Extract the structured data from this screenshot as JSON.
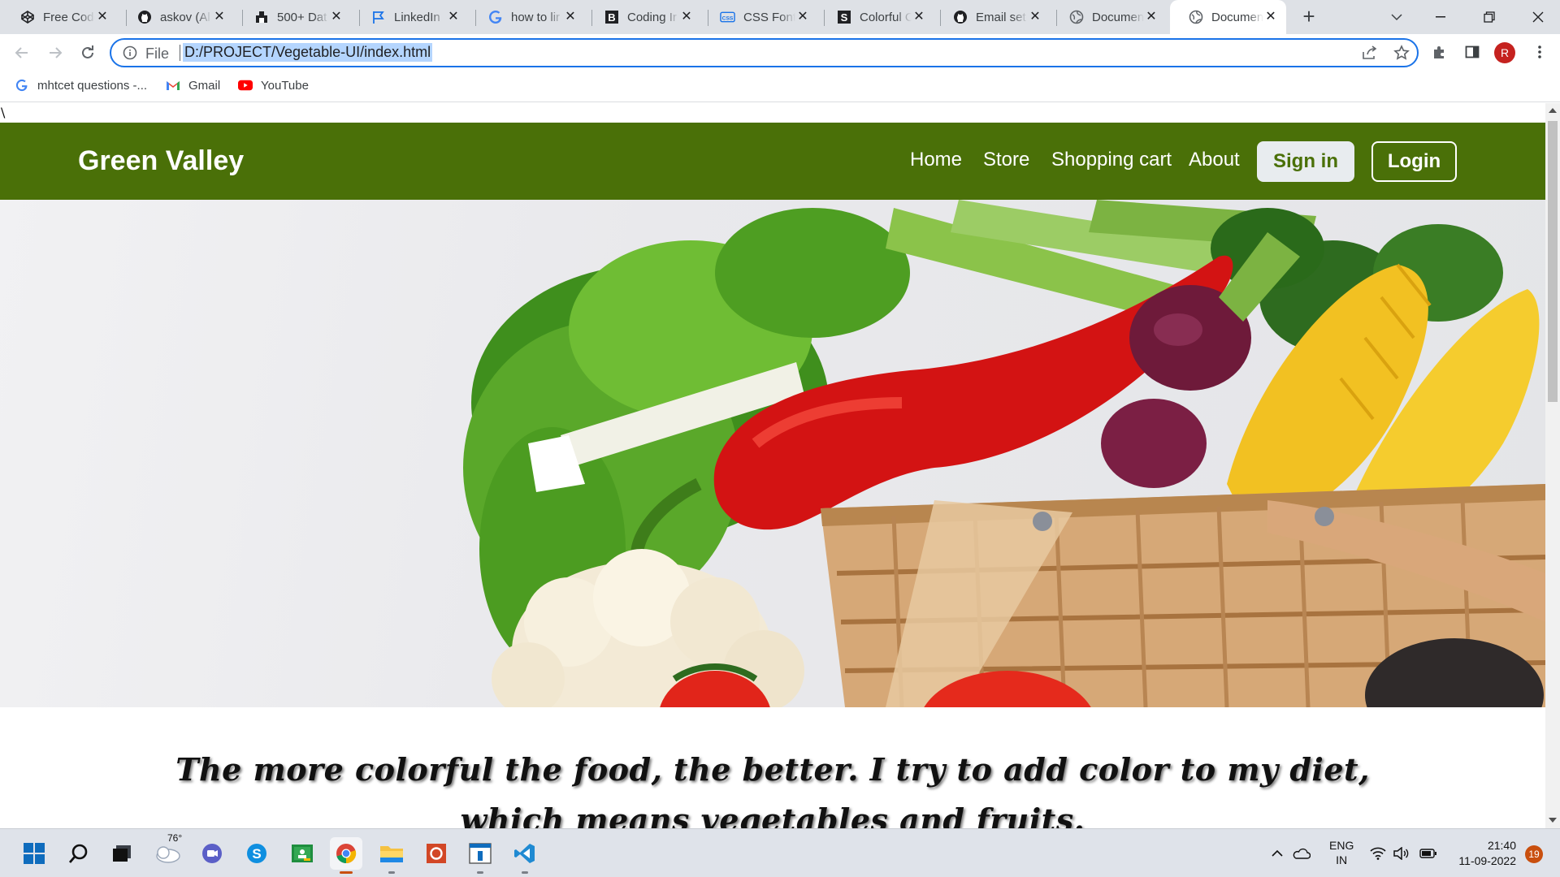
{
  "browser": {
    "tabs": [
      {
        "title": "Free Code",
        "icon": "codepen-icon"
      },
      {
        "title": "askov (Al",
        "icon": "github-icon"
      },
      {
        "title": "500+ Dat",
        "icon": "database-icon"
      },
      {
        "title": "LinkedIn",
        "icon": "flag-icon"
      },
      {
        "title": "how to lir",
        "icon": "google-icon"
      },
      {
        "title": "Coding Ir",
        "icon": "b-logo-icon"
      },
      {
        "title": "CSS Font",
        "icon": "css-icon"
      },
      {
        "title": "Colorful C",
        "icon": "s-logo-icon"
      },
      {
        "title": "Email set",
        "icon": "github-icon"
      },
      {
        "title": "Documen",
        "icon": "globe-icon"
      },
      {
        "title": "Documen",
        "icon": "globe-icon",
        "active": true
      }
    ],
    "address": {
      "scheme": "File",
      "url": "D:/PROJECT/Vegetable-UI/index.html"
    },
    "profile_initial": "R",
    "bookmarks": [
      {
        "label": "mhtcet questions -...",
        "icon": "google-icon"
      },
      {
        "label": "Gmail",
        "icon": "gmail-icon"
      },
      {
        "label": "YouTube",
        "icon": "youtube-icon"
      }
    ]
  },
  "page": {
    "stray_char": "\\",
    "brand": "Green Valley",
    "nav": [
      "Home",
      "Store",
      "Shopping cart",
      "About"
    ],
    "signin_label": "Sign in",
    "login_label": "Login",
    "quote_line1": "The more colorful the food, the better. I try to add color to my diet,",
    "quote_line2": "which means vegetables and fruits."
  },
  "taskbar": {
    "weather_temp": "76°",
    "lang_line1": "ENG",
    "lang_line2": "IN",
    "time": "21:40",
    "date": "11-09-2022",
    "notifications": "19"
  },
  "colors": {
    "header_green": "#4a7008",
    "omnibox_focus": "#1a73e8"
  }
}
